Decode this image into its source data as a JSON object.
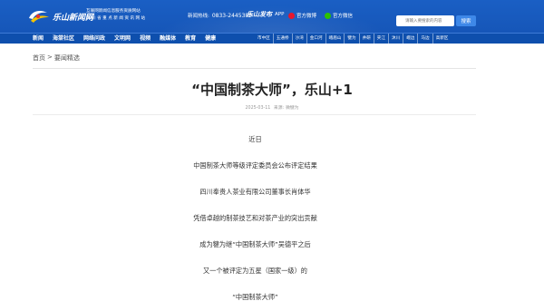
{
  "header": {
    "logo_text": "乐山新闻网",
    "slogan_line1": "互联网新闻信息服务资质网站",
    "slogan_line2": "四 川 省 重 点 新 闻 资 讯 网 站",
    "hotline_label": "新闻热线:",
    "hotline_number": "0833-2445385",
    "app_script": "乐山发布",
    "app_label": "APP",
    "weibo_label": "官方微博",
    "weixin_label": "官方微信",
    "search_placeholder": "请输入要搜索的内容",
    "search_button": "搜索"
  },
  "nav": {
    "main": [
      "新闻",
      "海棠社区",
      "网络问政",
      "文明网",
      "视频",
      "融媒体",
      "教育",
      "健康"
    ],
    "areas": [
      "市中区",
      "五通桥",
      "沙湾",
      "金口河",
      "峨眉山",
      "犍为",
      "井研",
      "夹江",
      "沐川",
      "峨边",
      "马边",
      "高新区"
    ]
  },
  "breadcrumb": {
    "home": "首页",
    "separator": ">",
    "section": "要闻精选"
  },
  "article": {
    "title": "“中国制茶大师”，乐山+1",
    "date": "2025-03-11",
    "source_label": "来源:",
    "source": "微犍为",
    "paragraphs": [
      "近日",
      "中国制茶大师等级评定委员会公布评定结果",
      "四川奉贵人茶业有限公司董事长肖体华",
      "凭借卓越的制茶技艺和对茶产业的突出贡献",
      "成为犍为继“中国制茶大师”吴德平之后",
      "又一个被评定为五星（国家一级）的",
      "“中国制茶大师”"
    ]
  },
  "colors": {
    "header_blue": "#1a5fc4",
    "nav_blue": "#0e4fad",
    "search_button": "#3e88e8",
    "weibo_red": "#e6162d",
    "weixin_green": "#2dc100"
  },
  "icons": [
    "logo-mark-icon",
    "phone-icon",
    "app-icon",
    "weibo-icon",
    "weixin-icon"
  ]
}
